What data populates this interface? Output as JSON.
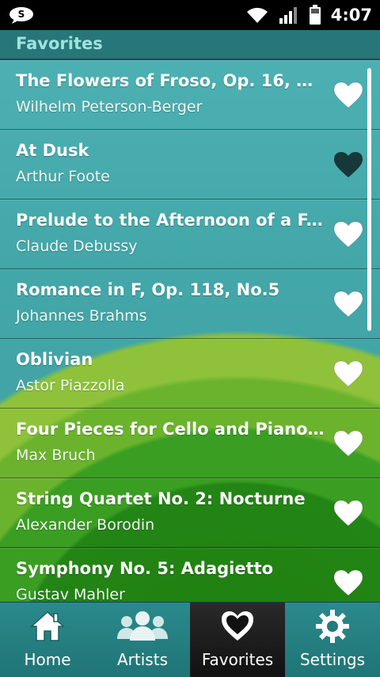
{
  "status_bar": {
    "time": "4:07"
  },
  "header": {
    "title": "Favorites"
  },
  "tracks": [
    {
      "title": "The Flowers of Froso, Op. 16, No...",
      "artist": "Wilhelm Peterson-Berger",
      "favorited": false
    },
    {
      "title": "At Dusk",
      "artist": "Arthur Foote",
      "favorited": true
    },
    {
      "title": "Prelude to the Afternoon of a F...",
      "artist": "Claude Debussy",
      "favorited": false
    },
    {
      "title": "Romance in F, Op. 118, No.5",
      "artist": "Johannes Brahms",
      "favorited": false
    },
    {
      "title": "Oblivian",
      "artist": "Astor Piazzolla",
      "favorited": false
    },
    {
      "title": "Four Pieces for Cello and Piano...",
      "artist": "Max Bruch",
      "favorited": false
    },
    {
      "title": "String Quartet No. 2: Nocturne",
      "artist": "Alexander Borodin",
      "favorited": false
    },
    {
      "title": "Symphony No. 5: Adagietto",
      "artist": "Gustav Mahler",
      "favorited": false
    }
  ],
  "tabs": [
    {
      "label": "Home",
      "icon": "home-icon",
      "active": false
    },
    {
      "label": "Artists",
      "icon": "artists-icon",
      "active": false
    },
    {
      "label": "Favorites",
      "icon": "heart-icon",
      "active": true
    },
    {
      "label": "Settings",
      "icon": "gear-icon",
      "active": false
    }
  ],
  "colors": {
    "accent": "#9fe3df",
    "heart_on": "#1a3a3a",
    "heart_off": "#ffffff"
  }
}
